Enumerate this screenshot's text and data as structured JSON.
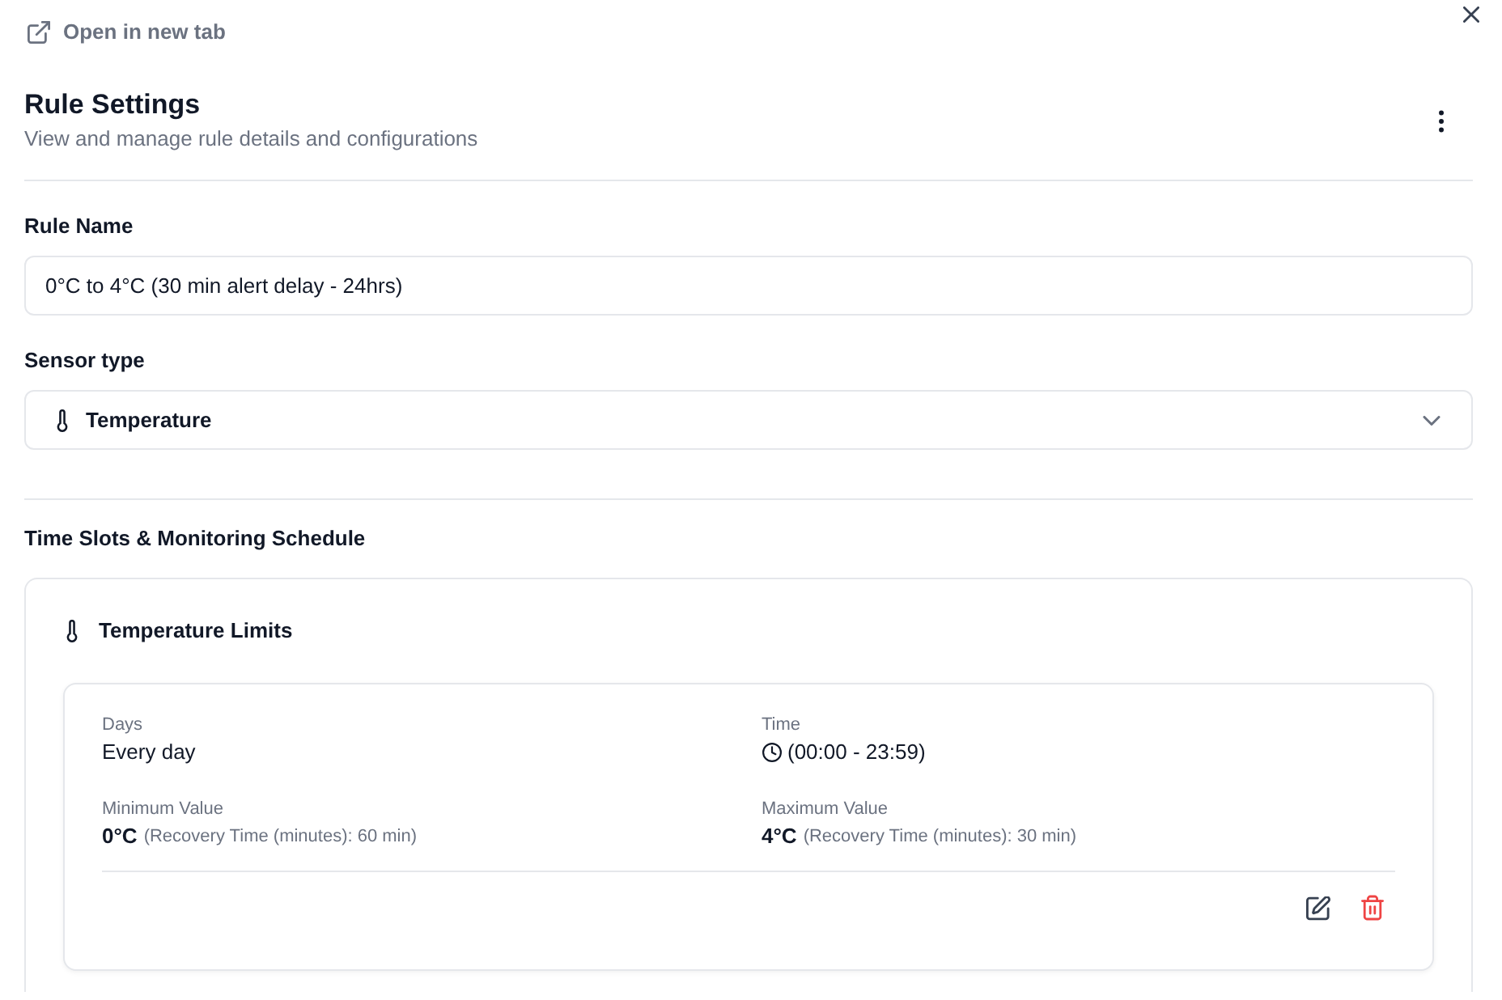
{
  "header": {
    "link": "Open in new tab",
    "title": "Rule Settings",
    "subtitle": "View and manage rule details and configurations"
  },
  "fields": [
    {
      "kind": "text",
      "label": "Rule Name",
      "value": "0°C to 4°C (30 min alert delay - 24hrs)"
    },
    {
      "kind": "select",
      "label": "Sensor type",
      "value": "Temperature"
    }
  ],
  "schedule": {
    "title": "Time Slots & Monitoring Schedule",
    "card_title": "Temperature Limits",
    "slots": [
      {
        "items": [
          {
            "kind": "text",
            "label": "Days",
            "value": "Every day"
          },
          {
            "kind": "time",
            "label": "Time",
            "value": "(00:00 - 23:59)"
          },
          {
            "kind": "limit",
            "label": "Minimum Value",
            "value": "0°C",
            "note": "(Recovery Time (minutes): 60 min)"
          },
          {
            "kind": "limit",
            "label": "Maximum Value",
            "value": "4°C",
            "note": "(Recovery Time (minutes): 30 min)"
          }
        ]
      }
    ]
  }
}
